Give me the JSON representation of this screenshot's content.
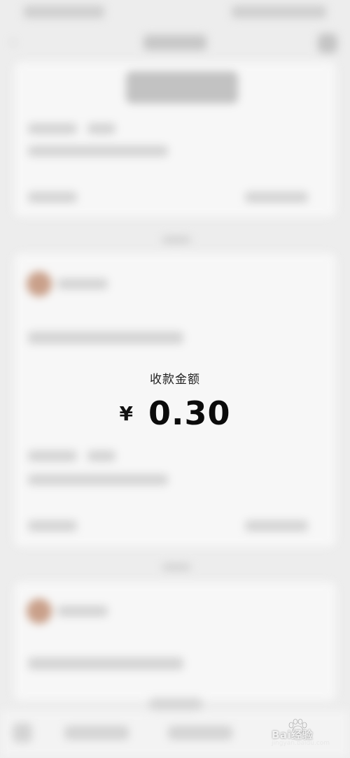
{
  "payment": {
    "label": "收款金额",
    "currency": "¥",
    "amount": "0.30"
  },
  "watermark": {
    "text": "Bai经验",
    "sub": "jingyan.baidu.com"
  },
  "colors": {
    "background": "#ededed",
    "card": "#f7f7f7",
    "amount_text": "#0b0b0b"
  },
  "icons": {
    "back": "chevron-left-icon",
    "more": "more-icon",
    "watermark": "baidu-paw-icon"
  }
}
